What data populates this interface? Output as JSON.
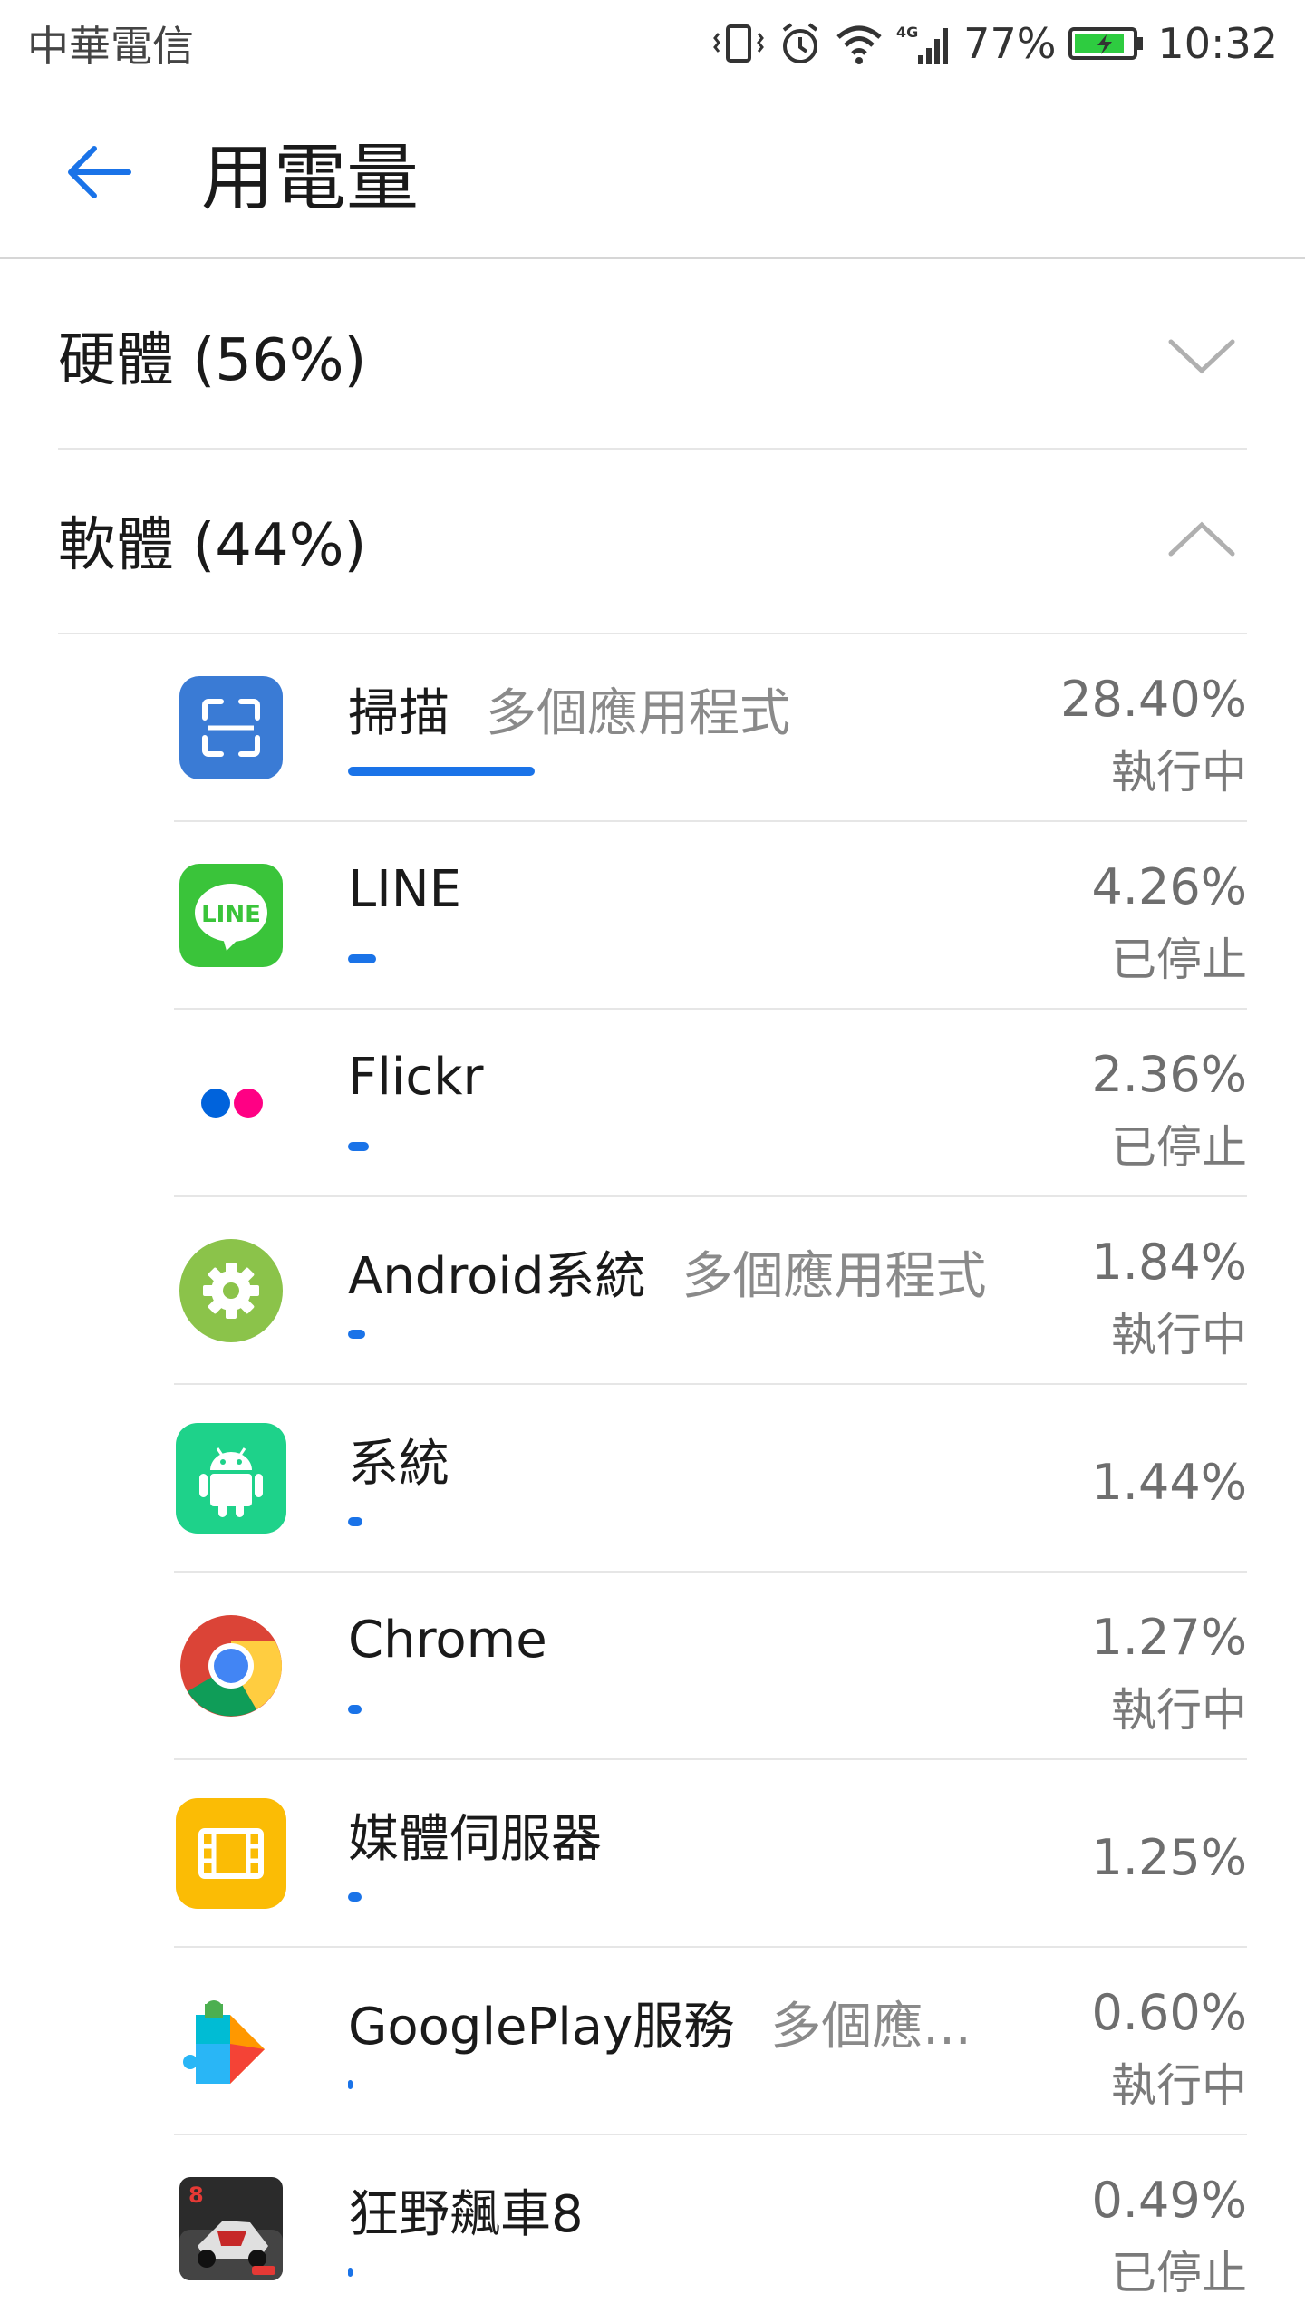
{
  "status_bar": {
    "carrier": "中華電信",
    "network": "4G",
    "battery_percent": "77%",
    "time": "10:32",
    "icons": [
      "vibrate-icon",
      "alarm-icon",
      "wifi-icon",
      "signal-icon",
      "battery-charging-icon"
    ]
  },
  "header": {
    "title": "用電量",
    "back_icon": "arrow-left-icon"
  },
  "sections": {
    "hardware": {
      "label": "硬體 (56%)",
      "expanded": false
    },
    "software": {
      "label": "軟體 (44%)",
      "expanded": true
    }
  },
  "apps": [
    {
      "name": "掃描",
      "sub": "多個應用程式",
      "percent": "28.40%",
      "state": "執行中",
      "usage": 28.4,
      "icon": "scan-icon"
    },
    {
      "name": "LINE",
      "sub": "",
      "percent": "4.26%",
      "state": "已停止",
      "usage": 4.26,
      "icon": "line-icon"
    },
    {
      "name": "Flickr",
      "sub": "",
      "percent": "2.36%",
      "state": "已停止",
      "usage": 2.36,
      "icon": "flickr-icon"
    },
    {
      "name": "Android系統",
      "sub": "多個應用程式",
      "percent": "1.84%",
      "state": "執行中",
      "usage": 1.84,
      "icon": "android-settings-icon"
    },
    {
      "name": "系統",
      "sub": "",
      "percent": "1.44%",
      "state": "",
      "usage": 1.44,
      "icon": "android-robot-icon"
    },
    {
      "name": "Chrome",
      "sub": "",
      "percent": "1.27%",
      "state": "執行中",
      "usage": 1.27,
      "icon": "chrome-icon"
    },
    {
      "name": "媒體伺服器",
      "sub": "",
      "percent": "1.25%",
      "state": "",
      "usage": 1.25,
      "icon": "film-icon"
    },
    {
      "name": "GooglePlay服務",
      "sub": "多個應...",
      "percent": "0.60%",
      "state": "執行中",
      "usage": 0.6,
      "icon": "google-play-services-icon"
    },
    {
      "name": "狂野飆車8",
      "sub": "",
      "percent": "0.49%",
      "state": "已停止",
      "usage": 0.49,
      "icon": "asphalt-8-icon"
    }
  ],
  "colors": {
    "accent": "#1a73e8",
    "line_green": "#3ac43a",
    "scan_blue": "#3a7bd5",
    "android_green": "#8bc34a",
    "system_teal": "#1ed28a",
    "media_yellow": "#fbbc05"
  }
}
